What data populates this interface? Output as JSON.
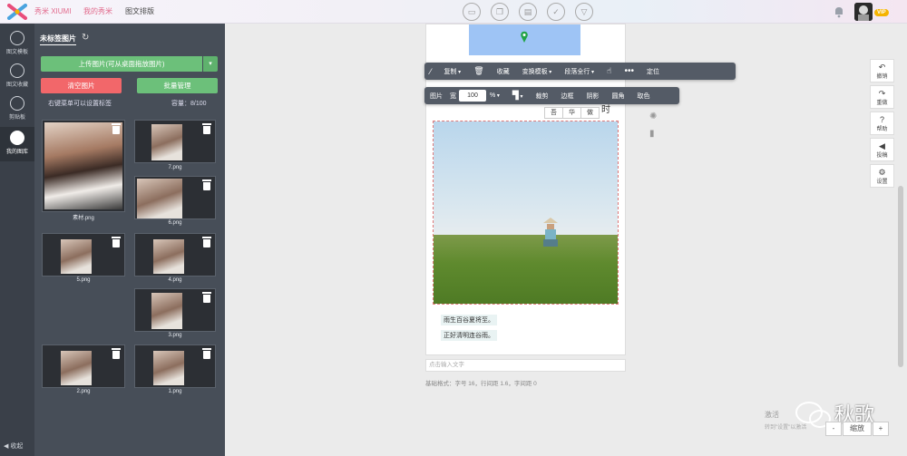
{
  "header": {
    "brand": "秀米 XIUMI",
    "nav": [
      "我的秀米",
      "图文排版"
    ],
    "vip_badge": "VIP"
  },
  "leftnav": {
    "items": [
      {
        "label": "图文模板"
      },
      {
        "label": "图文收藏"
      },
      {
        "label": "剪贴板"
      },
      {
        "label": "我的图库"
      }
    ],
    "collapse_label": "收起"
  },
  "panel": {
    "tab": "未标签图片",
    "upload_button": "上传图片(可从桌面拖放图片)",
    "clear_button": "清空图片",
    "batch_button": "批量管理",
    "hint": "右键菜单可以设置标签",
    "capacity": "容量：8/100",
    "thumbnails": [
      {
        "caption": "素材.png"
      },
      {
        "caption": "7.png"
      },
      {
        "caption": "6.png"
      },
      {
        "caption": "5.png"
      },
      {
        "caption": "4.png"
      },
      {
        "caption": "3.png"
      },
      {
        "caption": "2.png"
      },
      {
        "caption": "1.png"
      }
    ]
  },
  "toolbar1": {
    "items": [
      "复制",
      "收藏",
      "变换模板",
      "段落全行",
      "定位"
    ]
  },
  "toolbar2": {
    "image_label": "图片",
    "width_label": "宽",
    "width_value": "100",
    "percent": "%",
    "items": [
      "裁剪",
      "边框",
      "阴影",
      "圆角",
      "取色"
    ]
  },
  "vertical_chars": [
    "吾",
    "华",
    "做",
    "时"
  ],
  "captions": [
    "雨生百谷夏将至。",
    "正好清明连谷雨。"
  ],
  "text_input_placeholder": "点击输入文字",
  "style_info": "基础格式：字号 16，行间距 1.6，字间距 0",
  "right_panel": [
    {
      "label": "撤销",
      "glyph": "↶"
    },
    {
      "label": "重做",
      "glyph": "↷"
    },
    {
      "label": "帮助",
      "glyph": "?"
    },
    {
      "label": "投稿",
      "glyph": "◀"
    },
    {
      "label": "设置",
      "glyph": "⚙"
    }
  ],
  "watermark": "激活",
  "watermark_sub": "转到\"设置\"以激活",
  "signature": "秋歌",
  "zoom": [
    "-",
    "缩放",
    "+"
  ]
}
